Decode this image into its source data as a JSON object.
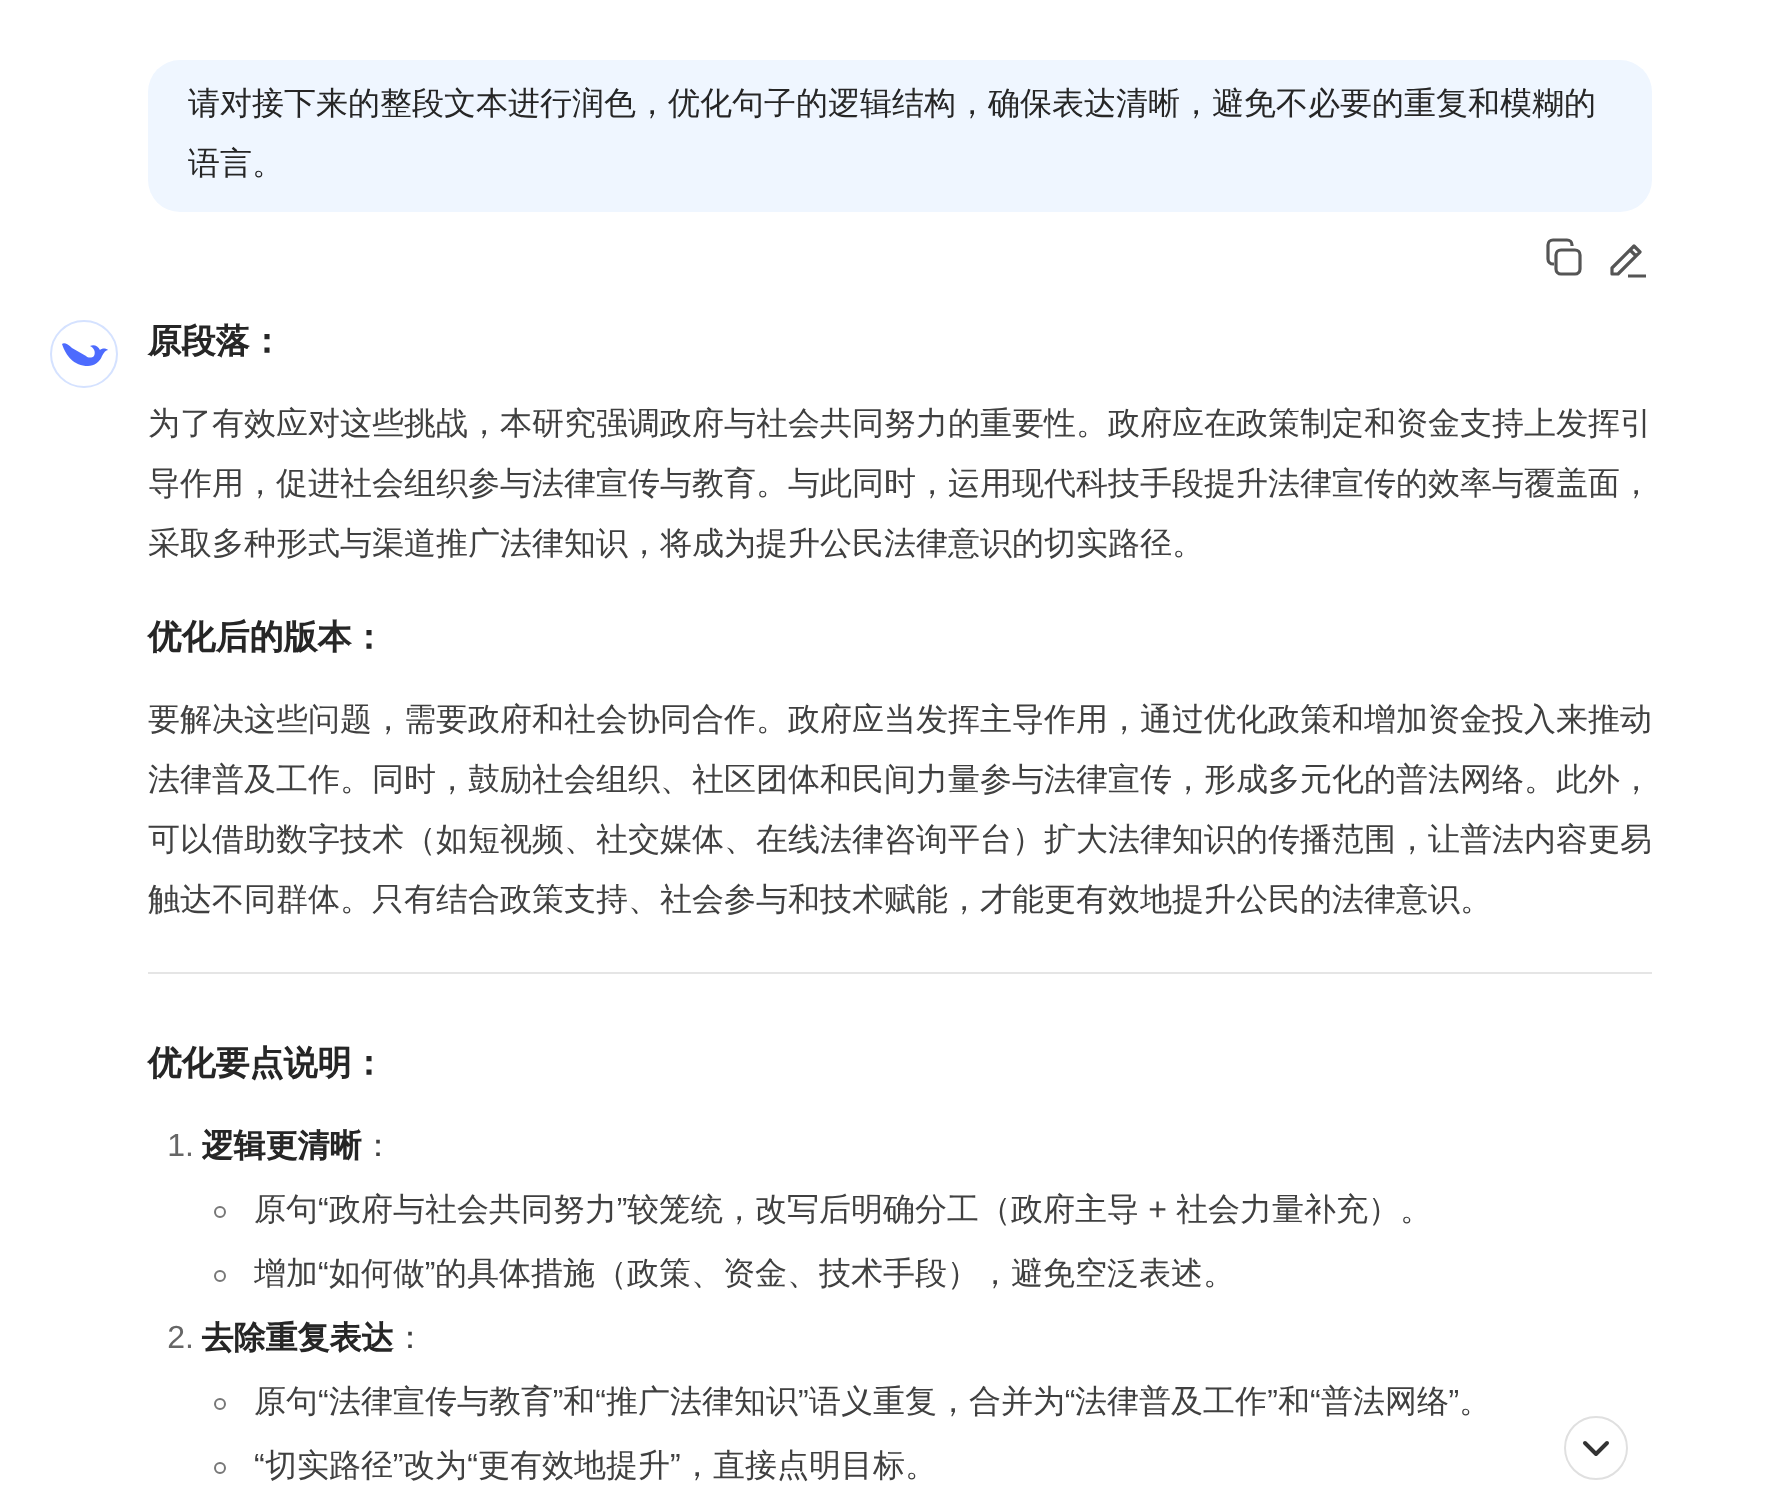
{
  "user_message": {
    "text": "请对接下来的整段文本进行润色，优化句子的逻辑结构，确保表达清晰，避免不必要的重复和模糊的语言。"
  },
  "reply": {
    "blocks": [
      {
        "kind": "heading",
        "text": "原段落："
      },
      {
        "kind": "paragraph",
        "text": "为了有效应对这些挑战，本研究强调政府与社会共同努力的重要性。政府应在政策制定和资金支持上发挥引导作用，促进社会组织参与法律宣传与教育。与此同时，运用现代科技手段提升法律宣传的效率与覆盖面，采取多种形式与渠道推广法律知识，将成为提升公民法律意识的切实路径。"
      },
      {
        "kind": "heading",
        "text": "优化后的版本："
      },
      {
        "kind": "paragraph",
        "text": "要解决这些问题，需要政府和社会协同合作。政府应当发挥主导作用，通过优化政策和增加资金投入来推动法律普及工作。同时，鼓励社会组织、社区团体和民间力量参与法律宣传，形成多元化的普法网络。此外，可以借助数字技术（如短视频、社交媒体、在线法律咨询平台）扩大法律知识的传播范围，让普法内容更易触达不同群体。只有结合政策支持、社会参与和技术赋能，才能更有效地提升公民的法律意识。"
      },
      {
        "kind": "divider"
      },
      {
        "kind": "heading",
        "text": "优化要点说明："
      },
      {
        "kind": "list",
        "items": [
          {
            "number": "1.",
            "title": "逻辑更清晰",
            "suffix": "：",
            "children": [
              {
                "text": "原句“政府与社会共同努力”较笼统，改写后明确分工（政府主导 + 社会力量补充）。"
              },
              {
                "text": "增加“如何做”的具体措施（政策、资金、技术手段），避免空泛表述。"
              }
            ]
          },
          {
            "number": "2.",
            "title": "去除重复表达",
            "suffix": "：",
            "children": [
              {
                "text": "原句“法律宣传与教育”和“推广法律知识”语义重复，合并为“法律普及工作”和“普法网络”。"
              },
              {
                "text": "“切实路径”改为“更有效地提升”，直接点明目标。"
              }
            ]
          }
        ]
      }
    ]
  }
}
